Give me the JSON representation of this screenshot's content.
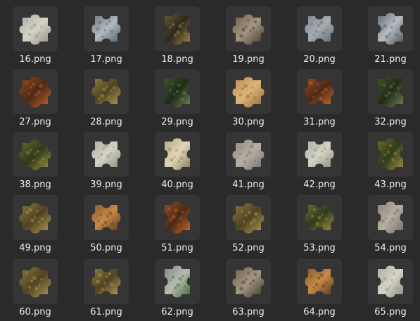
{
  "file_browser": {
    "items": [
      {
        "name": "16.png",
        "thumbnail": "puzzle-piece-sky-pale"
      },
      {
        "name": "17.png",
        "thumbnail": "puzzle-piece-sky-blue"
      },
      {
        "name": "18.png",
        "thumbnail": "puzzle-piece-grass-dark"
      },
      {
        "name": "19.png",
        "thumbnail": "puzzle-piece-rock-grey"
      },
      {
        "name": "20.png",
        "thumbnail": "puzzle-piece-sky-grey"
      },
      {
        "name": "21.png",
        "thumbnail": "puzzle-piece-sky-edge"
      },
      {
        "name": "27.png",
        "thumbnail": "puzzle-piece-rust-orange"
      },
      {
        "name": "28.png",
        "thumbnail": "puzzle-piece-dry-grass"
      },
      {
        "name": "29.png",
        "thumbnail": "puzzle-piece-green-leaves"
      },
      {
        "name": "30.png",
        "thumbnail": "puzzle-piece-sand"
      },
      {
        "name": "31.png",
        "thumbnail": "puzzle-piece-rust-orange"
      },
      {
        "name": "32.png",
        "thumbnail": "puzzle-piece-green-leaves"
      },
      {
        "name": "38.png",
        "thumbnail": "puzzle-piece-grass-edge"
      },
      {
        "name": "39.png",
        "thumbnail": "puzzle-piece-sky-pale"
      },
      {
        "name": "40.png",
        "thumbnail": "puzzle-piece-sand-light"
      },
      {
        "name": "41.png",
        "thumbnail": "puzzle-piece-sky-dusk"
      },
      {
        "name": "42.png",
        "thumbnail": "puzzle-piece-sky-pale"
      },
      {
        "name": "43.png",
        "thumbnail": "puzzle-piece-grass-edge"
      },
      {
        "name": "49.png",
        "thumbnail": "puzzle-piece-dry-grass"
      },
      {
        "name": "50.png",
        "thumbnail": "puzzle-piece-amber"
      },
      {
        "name": "51.png",
        "thumbnail": "puzzle-piece-rust-orange"
      },
      {
        "name": "52.png",
        "thumbnail": "puzzle-piece-dry-grass"
      },
      {
        "name": "53.png",
        "thumbnail": "puzzle-piece-grass-edge"
      },
      {
        "name": "54.png",
        "thumbnail": "puzzle-piece-sky-dusk"
      },
      {
        "name": "60.png",
        "thumbnail": "puzzle-piece-dry-grass"
      },
      {
        "name": "61.png",
        "thumbnail": "puzzle-piece-dry-grass"
      },
      {
        "name": "62.png",
        "thumbnail": "puzzle-piece-sky-green"
      },
      {
        "name": "63.png",
        "thumbnail": "puzzle-piece-rock-grey"
      },
      {
        "name": "64.png",
        "thumbnail": "puzzle-piece-amber"
      },
      {
        "name": "65.png",
        "thumbnail": "puzzle-piece-sky-pale"
      }
    ]
  },
  "palettes": {
    "puzzle-piece-sky-pale": [
      "#a9aea6",
      "#d6d3c4",
      "#8d8d82"
    ],
    "puzzle-piece-sky-blue": [
      "#6c7b86",
      "#b3b9bc",
      "#55616b"
    ],
    "puzzle-piece-grass-dark": [
      "#6a5a32",
      "#2c2a1e",
      "#a18445"
    ],
    "puzzle-piece-rock-grey": [
      "#6b5c4d",
      "#a49682",
      "#3e342d"
    ],
    "puzzle-piece-sky-grey": [
      "#7e8791",
      "#a7adb3",
      "#626a72"
    ],
    "puzzle-piece-sky-edge": [
      "#5c6a76",
      "#b7bcc0",
      "#4b5660"
    ],
    "puzzle-piece-rust-orange": [
      "#9b4a1f",
      "#4a2a17",
      "#c8672b"
    ],
    "puzzle-piece-dry-grass": [
      "#8c7a40",
      "#4f4322",
      "#b59b54"
    ],
    "puzzle-piece-green-leaves": [
      "#3e5a2c",
      "#1f2a19",
      "#6e8450"
    ],
    "puzzle-piece-sand": [
      "#b78a4f",
      "#dcb47a",
      "#8d6636"
    ],
    "puzzle-piece-grass-edge": [
      "#6d6a2e",
      "#2f3a1c",
      "#a0923e"
    ],
    "puzzle-piece-sand-light": [
      "#b6a783",
      "#e1d7b8",
      "#8a7b5c"
    ],
    "puzzle-piece-sky-dusk": [
      "#8e8478",
      "#b9aea0",
      "#6a6f75"
    ],
    "puzzle-piece-amber": [
      "#8a5a2b",
      "#c48a48",
      "#5a3a1e"
    ],
    "puzzle-piece-sky-green": [
      "#7d8780",
      "#b8bcb3",
      "#3f6a30"
    ]
  }
}
